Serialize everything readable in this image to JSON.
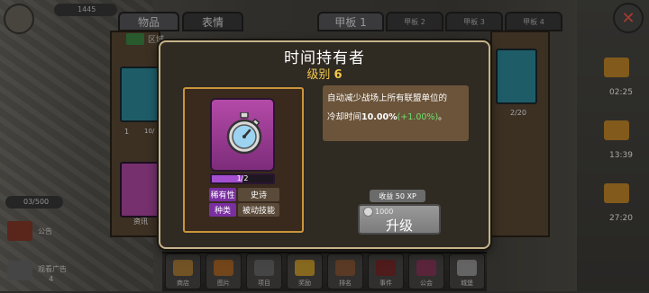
{
  "tabs": {
    "items": "物品",
    "emotes": "表情",
    "deck1": "甲板 1",
    "deck2": "甲板 2",
    "deck3": "甲板 3",
    "deck4": "甲板 4"
  },
  "top_left": {
    "counter": "1445"
  },
  "left_panel": {
    "filter_label": "区域",
    "card_count_1": "1",
    "card_progress_1": "10/",
    "card_label_2": "资讯",
    "left_counter": "03/500",
    "left_label_1": "公告",
    "left_label_2": "观看广告",
    "left_badge": "4"
  },
  "right_panel": {
    "card_count": "2/20",
    "timers": [
      "02:25",
      "13:39",
      "27:20"
    ]
  },
  "modal": {
    "title": "时间持有者",
    "level_label": "级别",
    "level_value": "6",
    "card_progress": "1/2",
    "card_progress_fraction": 0.5,
    "attributes": [
      {
        "key": "稀有性",
        "value": "史诗"
      },
      {
        "key": "种类",
        "value": "被动技能"
      }
    ],
    "description_line1": "自动减少战场上所有联盟单位的",
    "description_line2_prefix": "冷却时间",
    "description_value": "10.00%",
    "description_bonus": "(+1.00%)",
    "description_suffix": "。",
    "xp_reward": "收益 50 XP",
    "upgrade_cost": "1000",
    "upgrade_label": "升级"
  },
  "bottom_bar": {
    "labels": [
      "商店",
      "图片",
      "项目",
      "奖励",
      "排名",
      "事件",
      "公会",
      "城堡"
    ]
  },
  "colors": {
    "modal_border": "#c6b48a",
    "level_text": "#f2c94c",
    "card_purple": "#b44aa8",
    "bonus_green": "#6ee06e"
  }
}
